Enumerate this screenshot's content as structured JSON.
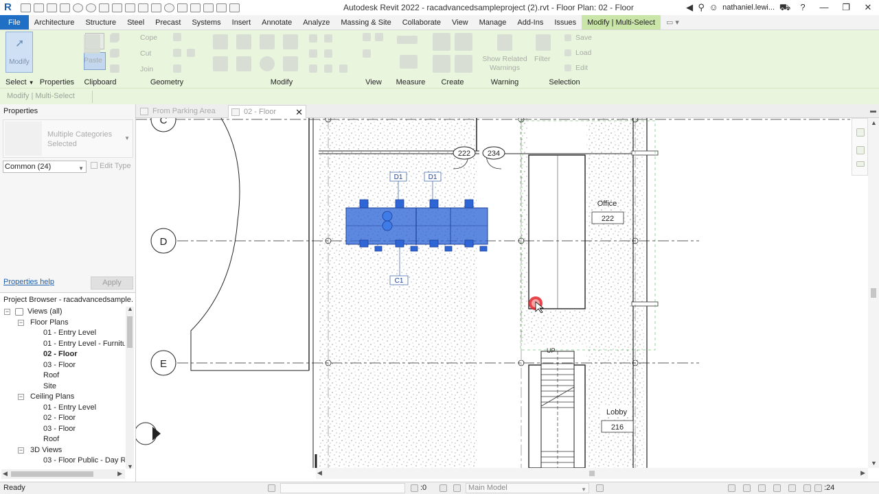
{
  "app": {
    "logo": "R",
    "window_title": "Autodesk Revit 2022 - racadvancedsampleproject (2).rvt - Floor Plan: 02 - Floor",
    "user_name": "nathaniel.lewi...",
    "window_buttons": [
      "—",
      "❐",
      "✕"
    ]
  },
  "ribbon_tabs": [
    {
      "label": "File",
      "kind": "file"
    },
    {
      "label": "Architecture"
    },
    {
      "label": "Structure"
    },
    {
      "label": "Steel"
    },
    {
      "label": "Precast"
    },
    {
      "label": "Systems"
    },
    {
      "label": "Insert"
    },
    {
      "label": "Annotate"
    },
    {
      "label": "Analyze"
    },
    {
      "label": "Massing & Site"
    },
    {
      "label": "Collaborate"
    },
    {
      "label": "View"
    },
    {
      "label": "Manage"
    },
    {
      "label": "Add-Ins"
    },
    {
      "label": "Issues"
    },
    {
      "label": "Modify | Multi-Select",
      "kind": "context"
    }
  ],
  "ribbon": {
    "modify_label": "Modify",
    "select_label": "Select",
    "properties_label": "Properties",
    "clipboard_label": "Clipboard",
    "geometry_label": "Geometry",
    "modify_group_label": "Modify",
    "view_label": "View",
    "measure_label": "Measure",
    "create_label": "Create",
    "warning_label": "Warning",
    "selection_label": "Selection",
    "paste_label": "Paste",
    "cope_label": "Cope",
    "cut_label": "Cut",
    "join_label": "Join",
    "show_related_warnings": "Show Related Warnings",
    "filter_label": "Filter",
    "save_label": "Save",
    "load_label": "Load",
    "edit_label": "Edit"
  },
  "options_bar": {
    "context": "Modify | Multi-Select"
  },
  "properties": {
    "title": "Properties",
    "type_name": "Multiple Categories Selected",
    "filter_value": "Common (24)",
    "edit_type": "Edit Type",
    "help_link": "Properties help",
    "apply": "Apply"
  },
  "project_browser": {
    "title": "Project Browser - racadvancedsample...",
    "nodes": [
      {
        "label": "Views (all)",
        "level": 0,
        "twisty": "−"
      },
      {
        "label": "Floor Plans",
        "level": 1,
        "twisty": "−"
      },
      {
        "label": "01 - Entry Level",
        "level": 2
      },
      {
        "label": "01 - Entry Level - Furnitur",
        "level": 2
      },
      {
        "label": "02 - Floor",
        "level": 2,
        "bold": true
      },
      {
        "label": "03 - Floor",
        "level": 2
      },
      {
        "label": "Roof",
        "level": 2
      },
      {
        "label": "Site",
        "level": 2
      },
      {
        "label": "Ceiling Plans",
        "level": 1,
        "twisty": "−"
      },
      {
        "label": "01 - Entry Level",
        "level": 2
      },
      {
        "label": "02 - Floor",
        "level": 2
      },
      {
        "label": "03 - Floor",
        "level": 2
      },
      {
        "label": "Roof",
        "level": 2
      },
      {
        "label": "3D Views",
        "level": 1,
        "twisty": "−"
      },
      {
        "label": "03 - Floor Public - Day Re",
        "level": 2
      }
    ]
  },
  "view_tabs": [
    {
      "label": "From Parking Area",
      "active": false
    },
    {
      "label": "02 - Floor",
      "active": true
    }
  ],
  "plan": {
    "grids": [
      "C",
      "D",
      "E"
    ],
    "door_tags": [
      "222",
      "234"
    ],
    "furniture_tags": [
      "D1",
      "D1",
      "C1"
    ],
    "rooms": [
      {
        "name": "Office",
        "number": "222"
      },
      {
        "name": "Lobby",
        "number": "216"
      }
    ],
    "stair_label": "UP",
    "selection_color": "#2f66d6",
    "cursor_marker_color": "#e3232b"
  },
  "status": {
    "text": "Ready",
    "counter": ":0",
    "model": "Main Model",
    "filter_count": ":24"
  }
}
